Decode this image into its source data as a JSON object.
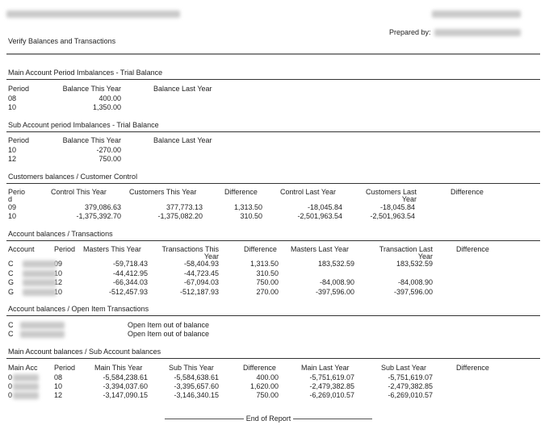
{
  "header": {
    "prepared_by_label": "Prepared by:",
    "title": "Verify Balances and Transactions"
  },
  "sections": [
    {
      "title": "Main Account Period Imbalances - Trial Balance",
      "columns": [
        "Period",
        "Balance This Year",
        "Balance Last Year"
      ],
      "rows": [
        [
          "08",
          "400.00",
          ""
        ],
        [
          "10",
          "1,350.00",
          ""
        ]
      ]
    },
    {
      "title": "Sub Account period Imbalances - Trial Balance",
      "columns": [
        "Period",
        "Balance This Year",
        "Balance Last Year"
      ],
      "rows": [
        [
          "10",
          "-270.00",
          ""
        ],
        [
          "12",
          "750.00",
          ""
        ]
      ]
    },
    {
      "title": "Customers balances / Customer Control",
      "columns": [
        "Perio\nd",
        "Control This Year",
        "Customers This Year",
        "Difference",
        "Control Last Year",
        "Customers Last\nYear",
        "Difference"
      ],
      "rows": [
        [
          "09",
          "379,086.63",
          "377,773.13",
          "1,313.50",
          "-18,045.84",
          "-18,045.84",
          ""
        ],
        [
          "10",
          "-1,375,392.70",
          "-1,375,082.20",
          "310.50",
          "-2,501,963.54",
          "-2,501,963.54",
          ""
        ]
      ]
    },
    {
      "title": "Account balances / Transactions",
      "columns": [
        "Account",
        "Period",
        "Masters This Year",
        "Transactions This\nYear",
        "Difference",
        "Masters Last Year",
        "Transaction Last\nYear",
        "Difference"
      ],
      "rows": [
        [
          "C",
          "09",
          "-59,718.43",
          "-58,404.93",
          "1,313.50",
          "183,532.59",
          "183,532.59",
          ""
        ],
        [
          "C",
          "10",
          "-44,412.95",
          "-44,723.45",
          "310.50",
          "",
          "",
          ""
        ],
        [
          "G",
          "12",
          "-66,344.03",
          "-67,094.03",
          "750.00",
          "-84,008.90",
          "-84,008.90",
          ""
        ],
        [
          "G",
          "10",
          "-512,457.93",
          "-512,187.93",
          "270.00",
          "-397,596.00",
          "-397,596.00",
          ""
        ]
      ]
    },
    {
      "title": "Account balances / Open Item Transactions",
      "columns": [],
      "rows": [
        [
          "C",
          "Open Item out of balance"
        ],
        [
          "C",
          "Open Item out of balance"
        ]
      ]
    },
    {
      "title": "Main Account balances / Sub Account balances",
      "columns": [
        "Main Acc",
        "Period",
        "Main This Year",
        "Sub This Year",
        "Difference",
        "Main Last Year",
        "Sub Last Year",
        "Difference"
      ],
      "rows": [
        [
          "0",
          "08",
          "-5,584,238.61",
          "-5,584,638.61",
          "400.00",
          "-5,751,619.07",
          "-5,751,619.07",
          ""
        ],
        [
          "0",
          "10",
          "-3,394,037.60",
          "-3,395,657.60",
          "1,620.00",
          "-2,479,382.85",
          "-2,479,382.85",
          ""
        ],
        [
          "0",
          "12",
          "-3,147,090.15",
          "-3,146,340.15",
          "750.00",
          "-6,269,010.57",
          "-6,269,010.57",
          ""
        ]
      ]
    }
  ],
  "footer": {
    "end_label": "End of Report"
  }
}
